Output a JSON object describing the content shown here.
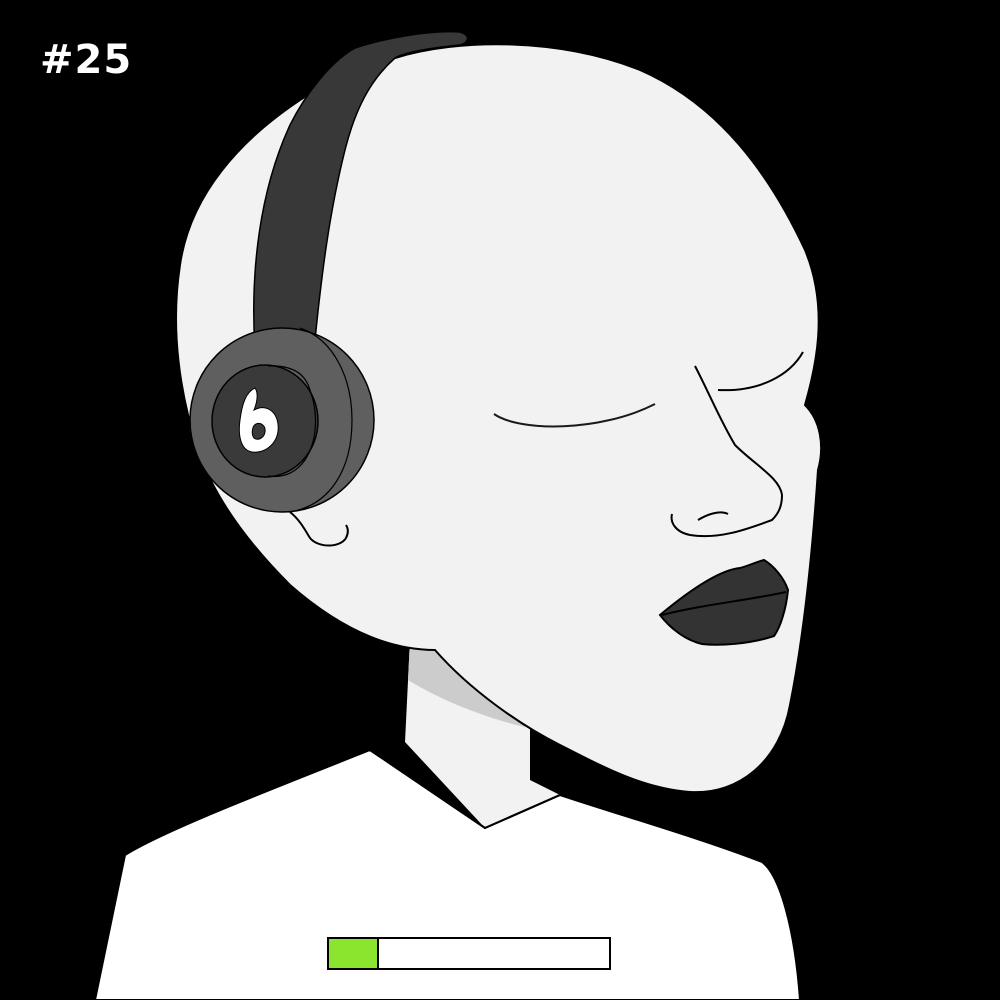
{
  "edition": {
    "label": "#25"
  },
  "shirt_badge": {
    "level": 0.18,
    "fill_color": "#8be52f",
    "track_color": "#ffffff"
  },
  "colors": {
    "background": "#000000",
    "skin": "#f2f2f2",
    "neck_shadow": "#cccccc",
    "shirt": "#ffffff",
    "headphone_band": "#383838",
    "headphone_cup": "#5f5f5f",
    "headphone_pad": "#3a3a3a",
    "lips": "#333333",
    "outline": "#000000"
  },
  "icons": {
    "headphone_logo": "beats-style-b-icon"
  }
}
